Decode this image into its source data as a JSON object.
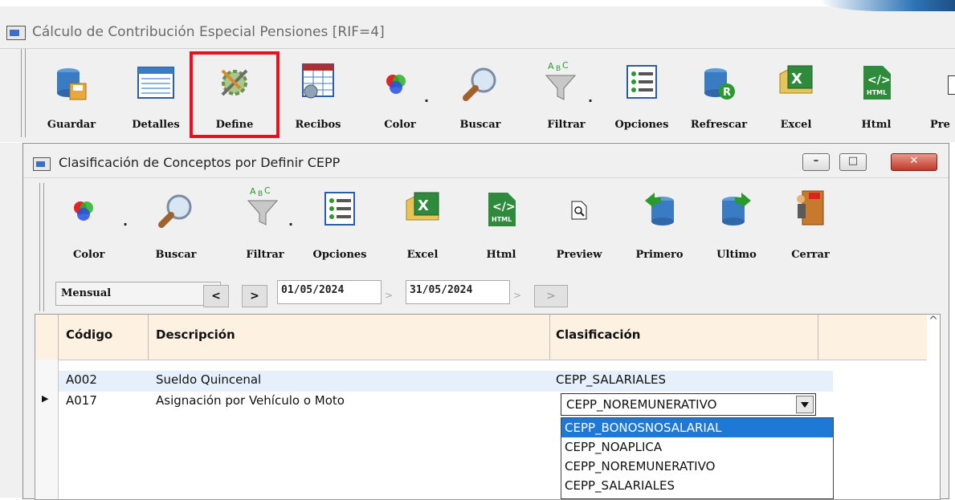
{
  "outer_window": {
    "title": "Cálculo de Contribución Especial Pensiones [RIF=4]"
  },
  "outer_toolbar": {
    "buttons": [
      {
        "label": "Guardar",
        "icon": "database-save-icon"
      },
      {
        "label": "Detalles",
        "icon": "details-window-icon"
      },
      {
        "label": "Define",
        "icon": "define-tools-icon",
        "highlighted": true
      },
      {
        "label": "Recibos",
        "icon": "receipts-grid-icon"
      },
      {
        "label": "Color",
        "icon": "color-palette-icon"
      },
      {
        "label": "Buscar",
        "icon": "magnifier-icon"
      },
      {
        "label": "Filtrar",
        "icon": "filter-funnel-icon"
      },
      {
        "label": "Opciones",
        "icon": "options-list-icon"
      },
      {
        "label": "Refrescar",
        "icon": "refresh-database-icon"
      },
      {
        "label": "Excel",
        "icon": "excel-icon"
      },
      {
        "label": "Html",
        "icon": "html-icon"
      },
      {
        "label": "Pre",
        "icon": "preview-icon"
      }
    ],
    "highlight_color": "#e8101a"
  },
  "inner_window": {
    "title": "Clasificación de Conceptos por Definir CEPP",
    "controls": {
      "minimize": "–",
      "maximize": "□",
      "close": "✕"
    }
  },
  "inner_toolbar": {
    "buttons": [
      {
        "label": "Color",
        "icon": "color-palette-icon"
      },
      {
        "label": "Buscar",
        "icon": "magnifier-icon"
      },
      {
        "label": "Filtrar",
        "icon": "filter-funnel-icon"
      },
      {
        "label": "Opciones",
        "icon": "options-list-icon"
      },
      {
        "label": "Excel",
        "icon": "excel-icon"
      },
      {
        "label": "Html",
        "icon": "html-icon"
      },
      {
        "label": "Preview",
        "icon": "preview-page-icon"
      },
      {
        "label": "Primero",
        "icon": "first-record-icon"
      },
      {
        "label": "Ultimo",
        "icon": "last-record-icon"
      },
      {
        "label": "Cerrar",
        "icon": "exit-door-icon"
      }
    ]
  },
  "period": {
    "selected": "Mensual",
    "prev_label": "<",
    "next_label": ">",
    "date_from": "01/05/2024",
    "date_to": "31/05/2024",
    "go_label": ">"
  },
  "grid": {
    "columns": [
      "Código",
      "Descripción",
      "Clasificación"
    ],
    "rows": [
      {
        "codigo": "A002",
        "descripcion": "Sueldo Quincenal",
        "clasificacion": "CEPP_SALARIALES"
      },
      {
        "codigo": "A017",
        "descripcion": "Asignación por Vehículo o Moto",
        "clasificacion": "CEPP_NOREMUNERATIVO"
      }
    ],
    "dropdown_options": [
      "CEPP_BONOSNOSALARIAL",
      "CEPP_NOAPLICA",
      "CEPP_NOREMUNERATIVO",
      "CEPP_SALARIALES"
    ],
    "dropdown_highlighted": "CEPP_BONOSNOSALARIAL",
    "scroll_up": "^"
  },
  "colors": {
    "header_bg": "#fdf2e1",
    "selection": "#1e78d6",
    "row_bg": "#e6f0fb"
  }
}
